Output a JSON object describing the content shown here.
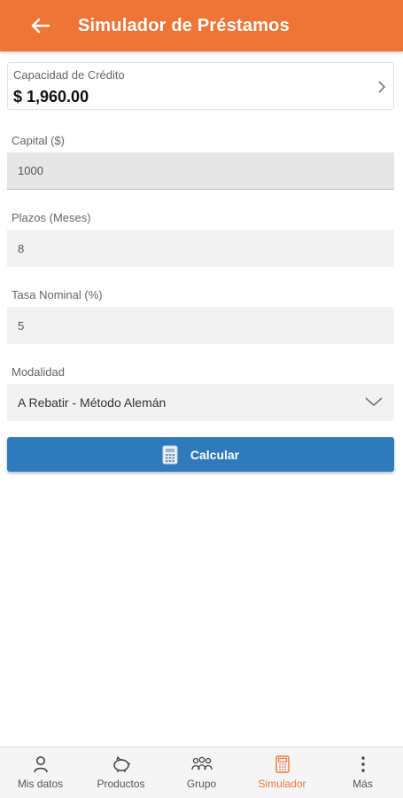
{
  "header": {
    "title": "Simulador de Préstamos"
  },
  "credit": {
    "label": "Capacidad de Crédito",
    "value": "$ 1,960.00"
  },
  "form": {
    "capital": {
      "label": "Capital ($)",
      "value": "1000"
    },
    "plazos": {
      "label": "Plazos (Meses)",
      "value": "8"
    },
    "tasa": {
      "label": "Tasa Nominal (%)",
      "value": "5"
    },
    "modalidad": {
      "label": "Modalidad",
      "value": "A Rebatir - Método Alemán"
    }
  },
  "calculate_button": {
    "label": "Calcular",
    "icon": "calculator-icon"
  },
  "bottom_nav": {
    "items": [
      {
        "label": "Mis datos",
        "icon": "person-icon"
      },
      {
        "label": "Productos",
        "icon": "piggy-bank-icon"
      },
      {
        "label": "Grupo",
        "icon": "group-icon"
      },
      {
        "label": "Simulador",
        "icon": "calculator-icon",
        "active": true
      },
      {
        "label": "Más",
        "icon": "more-vertical-icon"
      }
    ]
  },
  "colors": {
    "primary": "#ef7537",
    "button": "#2f79bd",
    "field_bg": "#f2f2f2"
  }
}
